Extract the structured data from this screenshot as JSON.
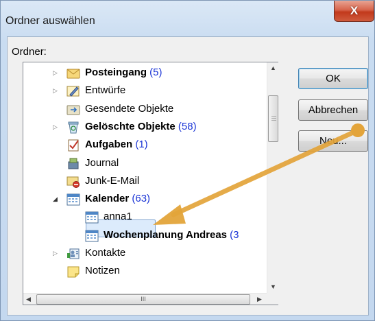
{
  "window": {
    "title": "Ordner auswählen",
    "close_glyph": "X"
  },
  "folder_label": "Ordner:",
  "tree": [
    {
      "label": "Posteingang",
      "count": "(5)",
      "bold": true,
      "expander": "collapsed",
      "icon": "inbox-icon"
    },
    {
      "label": "Entwürfe",
      "count": "",
      "bold": false,
      "expander": "collapsed",
      "icon": "drafts-icon"
    },
    {
      "label": "Gesendete Objekte",
      "count": "",
      "bold": false,
      "expander": "none",
      "icon": "sent-items-icon"
    },
    {
      "label": "Gelöschte Objekte",
      "count": "(58)",
      "bold": true,
      "expander": "collapsed",
      "icon": "deleted-items-icon"
    },
    {
      "label": "Aufgaben",
      "count": "(1)",
      "bold": true,
      "expander": "none",
      "icon": "tasks-icon"
    },
    {
      "label": "Journal",
      "count": "",
      "bold": false,
      "expander": "none",
      "icon": "journal-icon"
    },
    {
      "label": "Junk-E-Mail",
      "count": "",
      "bold": false,
      "expander": "none",
      "icon": "junk-mail-icon"
    },
    {
      "label": "Kalender",
      "count": "(63)",
      "bold": true,
      "expander": "expanded",
      "icon": "calendar-icon"
    },
    {
      "label": "anna1",
      "count": "",
      "bold": false,
      "expander": "none",
      "icon": "calendar-icon",
      "selected": true
    },
    {
      "label": "Wochenplanung Andreas",
      "count": "(3",
      "bold": true,
      "expander": "none",
      "icon": "calendar-icon"
    },
    {
      "label": "Kontakte",
      "count": "",
      "bold": false,
      "expander": "collapsed",
      "icon": "contacts-icon"
    },
    {
      "label": "Notizen",
      "count": "",
      "bold": false,
      "expander": "none",
      "icon": "notes-icon"
    }
  ],
  "buttons": {
    "ok": "OK",
    "cancel": "Abbrechen",
    "new": "Neu..."
  },
  "scrollbar": {
    "thumb_grip": "III"
  },
  "colors": {
    "count_blue": "#1a34d6",
    "annotation_arrow": "#e3a43a",
    "close_red": "#c2391c"
  }
}
